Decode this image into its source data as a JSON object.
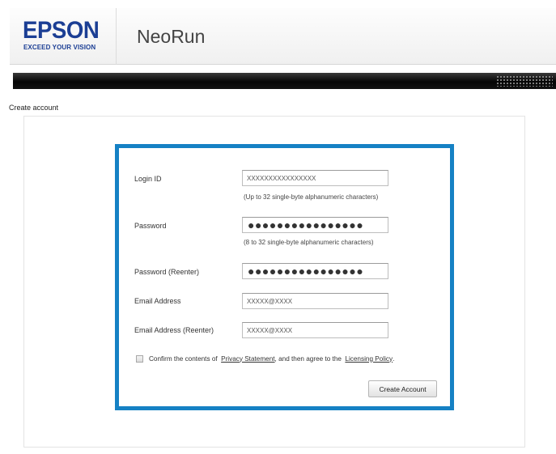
{
  "header": {
    "logo_text": "EPSON",
    "logo_tagline": "EXCEED YOUR VISION",
    "app_title": "NeoRun"
  },
  "page": {
    "section_title": "Create account"
  },
  "form": {
    "login_id": {
      "label": "Login ID",
      "value": "XXXXXXXXXXXXXXXX",
      "hint": "(Up to 32 single-byte alphanumeric characters)"
    },
    "password": {
      "label": "Password",
      "value": "●●●●●●●●●●●●●●●●",
      "hint": "(8 to 32 single-byte alphanumeric characters)"
    },
    "password_reenter": {
      "label": "Password (Reenter)",
      "value": "●●●●●●●●●●●●●●●●"
    },
    "email": {
      "label": "Email Address",
      "value": "XXXXX@XXXX"
    },
    "email_reenter": {
      "label": "Email Address (Reenter)",
      "value": "XXXXX@XXXX"
    },
    "consent": {
      "checked": false,
      "text_1": "Confirm the contents of",
      "privacy_link": "Privacy Statement",
      "text_2": ", and then agree to the",
      "licensing_link": "Licensing Policy",
      "text_3": "."
    },
    "submit_label": "Create Account"
  },
  "colors": {
    "brand": "#1b3e94",
    "highlight_frame": "#1581c4",
    "nav_bar": "#0a0a0a"
  }
}
